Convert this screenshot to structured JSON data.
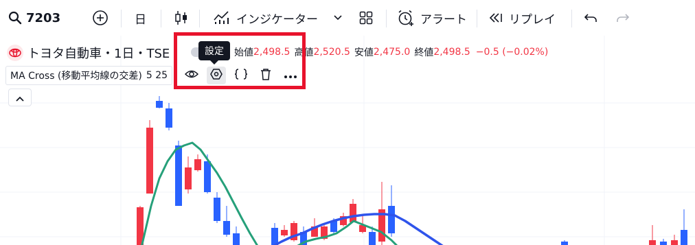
{
  "toolbar": {
    "symbol": "7203",
    "interval": "日",
    "indicators_label": "インジケーター",
    "alert_label": "アラート",
    "replay_label": "リプレイ"
  },
  "legend": {
    "symbol_title": "トヨタ自動車・1日・TSE",
    "open_label": "始値",
    "open_value": "2,498.5",
    "high_label": "高値",
    "high_value": "2,520.5",
    "low_label": "安値",
    "low_value": "2,475.0",
    "close_label": "終値",
    "close_value": "2,498.5",
    "change": "−0.5 (−0.02%)"
  },
  "indicator": {
    "name": "MA Cross (移動平均線の交差)",
    "params": "5 25",
    "tooltip": "設定",
    "actions": [
      "eye-icon",
      "settings-icon",
      "source-code-icon",
      "trash-icon",
      "more-icon"
    ]
  },
  "colors": {
    "up": "#2962ff",
    "down": "#f23645",
    "ma_fast": "#26a07a",
    "ma_slow": "#2f54eb",
    "highlight": "#e8132c"
  }
}
